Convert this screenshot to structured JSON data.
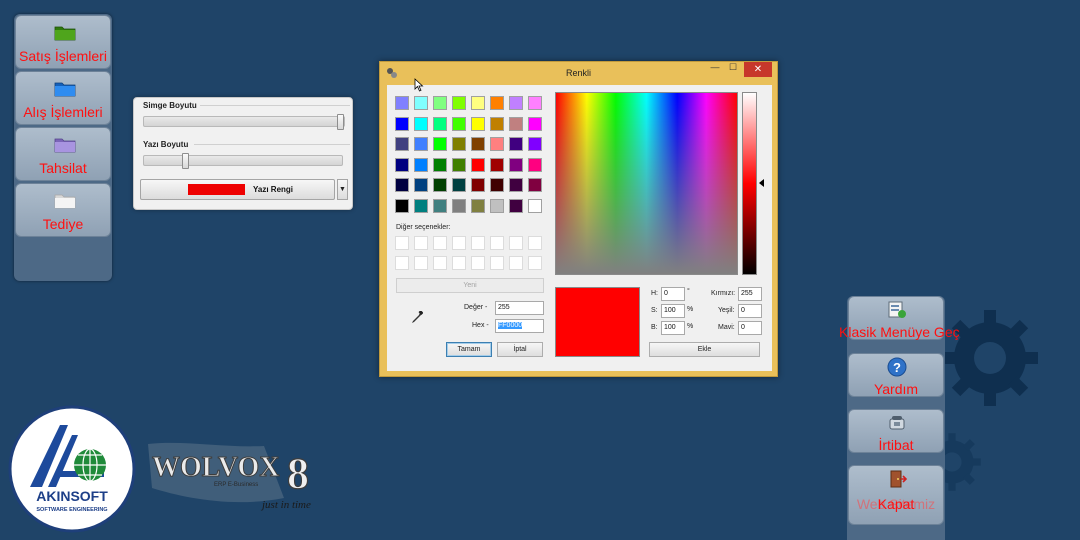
{
  "left_menu": {
    "items": [
      {
        "label": "Satış İşlemleri",
        "folder_color": "#3f8f14"
      },
      {
        "label": "Alış İşlemleri",
        "folder_color": "#1e7de0"
      },
      {
        "label": "Tahsilat",
        "folder_color": "#9b85d8"
      },
      {
        "label": "Tediye",
        "folder_color": "#eeeeee"
      }
    ]
  },
  "settings_panel": {
    "icon_size_label": "Simge Boyutu",
    "icon_size_level": 1.0,
    "font_size_label": "Yazı Boyutu",
    "font_size_level": 0.2,
    "text_color_label": "Yazı Rengi",
    "text_color": "#ee0000"
  },
  "color_dialog": {
    "title": "Renkli",
    "close_glyph": "✕",
    "min_glyph": "—",
    "max_glyph": "☐",
    "basic_colors": [
      [
        "#8080ff",
        "#80ffff",
        "#80ff80",
        "#80ff00",
        "#ffff80",
        "#ff8000",
        "#c080ff",
        "#ff80ff"
      ],
      [
        "#0000ff",
        "#00ffff",
        "#00ff80",
        "#40ff00",
        "#ffff00",
        "#c08000",
        "#c08080",
        "#ff00ff"
      ],
      [
        "#404080",
        "#4080ff",
        "#00ff00",
        "#808000",
        "#804000",
        "#ff8080",
        "#400080",
        "#8000ff"
      ],
      [
        "#000080",
        "#0080ff",
        "#008000",
        "#408000",
        "#ff0000",
        "#a00000",
        "#800080",
        "#ff0080"
      ],
      [
        "#000040",
        "#004080",
        "#004000",
        "#004040",
        "#800000",
        "#400000",
        "#400040",
        "#800040"
      ],
      [
        "#000000",
        "#008080",
        "#408080",
        "#808080",
        "#808040",
        "#c0c0c0",
        "#400040",
        "#ffffff"
      ]
    ],
    "custom_colors_label": "Diğer seçenekler:",
    "new_button": "Yeni",
    "value_label": "Değer -",
    "value": "255",
    "hex_label": "Hex -",
    "hex": "FF0000",
    "ok_button": "Tamam",
    "cancel_button": "İptal",
    "h_label": "H:",
    "h_value": "0",
    "h_unit": "°",
    "s_label": "S:",
    "s_value": "100",
    "s_unit": "%",
    "b_label": "B:",
    "b_value": "100",
    "b_unit": "%",
    "red_label": "Kırmızı:",
    "red_value": "255",
    "green_label": "Yeşil:",
    "green_value": "0",
    "blue_label": "Mavi:",
    "blue_value": "0",
    "add_button": "Ekle",
    "selected_color": "#ff0000"
  },
  "right_menu": {
    "items": [
      {
        "label": "Klasik Menüye Geç",
        "icon": "classic-menu-icon"
      },
      {
        "label": "Yardım",
        "icon": "help-icon"
      },
      {
        "label": "İrtibat",
        "icon": "phone-icon"
      },
      {
        "label": "Kapat",
        "icon": "exit-door-icon",
        "overlap_label": "Web Sitemiz"
      }
    ]
  },
  "logos": {
    "akinsoft_name": "AKINSOFT",
    "akinsoft_tagline": "SOFTWARE ENGINEERING",
    "wolvox_name": "WOLVOX",
    "wolvox_version": "8",
    "wolvox_sub": "ERP E-Business",
    "wolvox_slogan": "just in time"
  }
}
